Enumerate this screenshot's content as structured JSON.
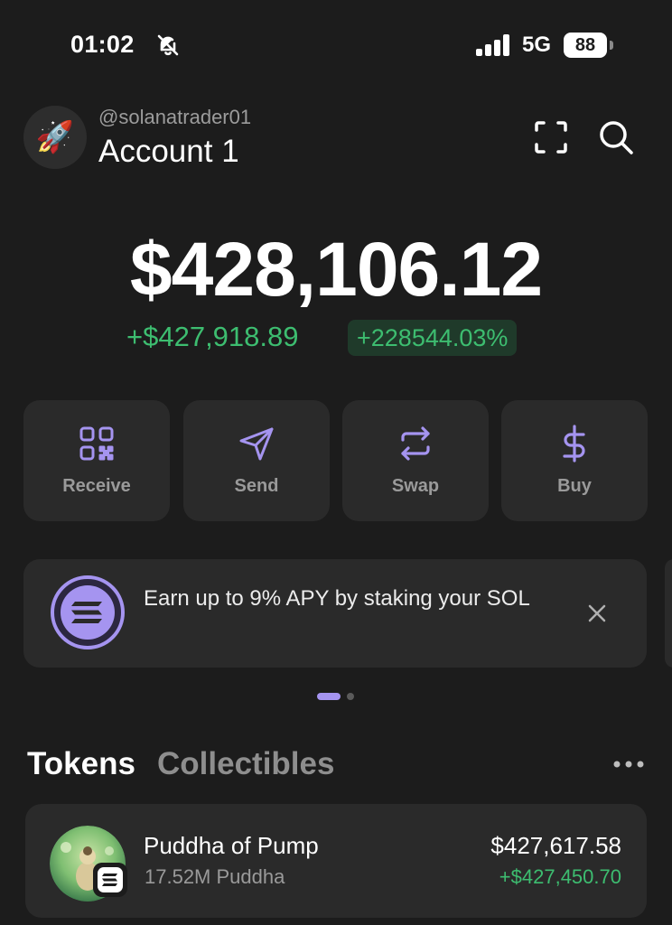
{
  "status_bar": {
    "time": "01:02",
    "network": "5G",
    "battery": "88"
  },
  "account": {
    "handle": "@solanatrader01",
    "name": "Account 1",
    "avatar_emoji": "🚀"
  },
  "balance": {
    "total": "$428,106.12",
    "change_value": "+$427,918.89",
    "change_percent": "+228544.03%"
  },
  "actions": [
    {
      "label": "Receive",
      "icon": "qr-code-icon"
    },
    {
      "label": "Send",
      "icon": "send-icon"
    },
    {
      "label": "Swap",
      "icon": "swap-icon"
    },
    {
      "label": "Buy",
      "icon": "dollar-icon"
    }
  ],
  "banner": {
    "text": "Earn up to 9% APY by staking your SOL"
  },
  "tabs": {
    "tokens": "Tokens",
    "collectibles": "Collectibles"
  },
  "tokens": [
    {
      "name": "Puddha of Pump",
      "amount": "17.52M Puddha",
      "value": "$427,617.58",
      "change": "+$427,450.70"
    }
  ],
  "colors": {
    "accent": "#a594f0",
    "positive": "#3dbd70",
    "background": "#1c1c1c",
    "card": "#2a2a2a"
  }
}
